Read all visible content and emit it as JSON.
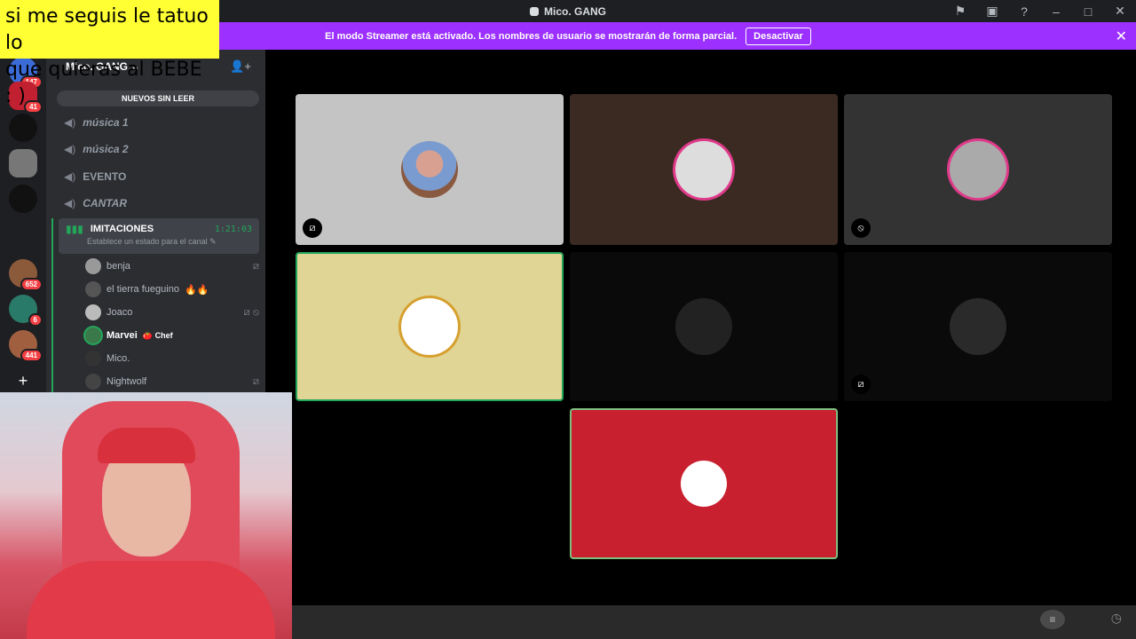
{
  "overlay": {
    "line1": "si me seguis le tatuo lo",
    "line2": "que quieras al BEBE : )"
  },
  "window": {
    "title": "Mico. GANG"
  },
  "banner": {
    "message": "El modo Streamer está activado. Los nombres de usuario se mostrarán de forma parcial.",
    "button": "Desactivar",
    "close": "✕"
  },
  "rail": {
    "badges": [
      "147",
      "41",
      "652",
      "6",
      "441"
    ],
    "add": "+"
  },
  "sidebar": {
    "server_name": "Mico. GANG",
    "unread_pill": "NUEVOS SIN LEER",
    "channels": [
      {
        "label": "música 1"
      },
      {
        "label": "música 2"
      },
      {
        "label": "EVENTO"
      },
      {
        "label": "CANTAR"
      }
    ],
    "active_channel": {
      "label": "IMITACIONES",
      "time": "1:21:03",
      "status": "Establece un estado para el canal"
    },
    "users": [
      {
        "name": "benja"
      },
      {
        "name": "el tierra fueguino"
      },
      {
        "name": "Joaco"
      },
      {
        "name": "Marvei",
        "tag": "Chef"
      },
      {
        "name": "Mico."
      },
      {
        "name": "Nightwolf"
      }
    ]
  },
  "colors": {
    "accent": "#9b30ff",
    "speaking": "#23a55a",
    "tile_red": "#c8202e",
    "tile_yellow": "#e0d595"
  }
}
